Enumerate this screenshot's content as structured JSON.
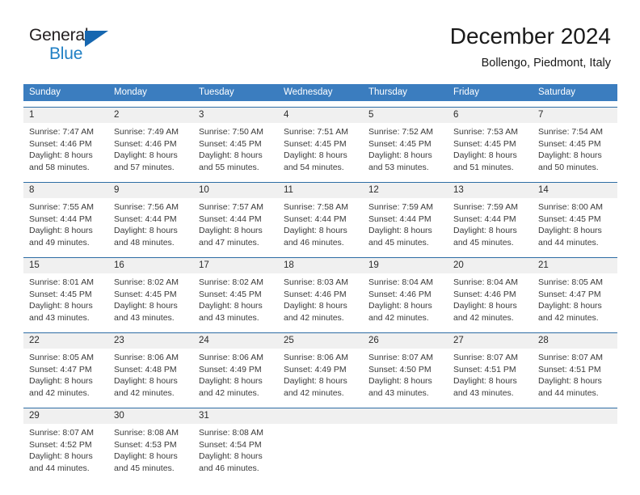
{
  "brand": {
    "name_primary": "General",
    "name_secondary": "Blue",
    "triangle_color": "#1667b0",
    "primary_color": "#231f20",
    "secondary_color": "#1f7fc4"
  },
  "header": {
    "title": "December 2024",
    "subtitle": "Bollengo, Piedmont, Italy"
  },
  "theme": {
    "header_bg": "#3b7dbf",
    "header_text": "#ffffff",
    "week_rule": "#2e6da4",
    "daynum_bg": "#f0f0f0",
    "body_text": "#3a3a3a"
  },
  "weekdays": [
    "Sunday",
    "Monday",
    "Tuesday",
    "Wednesday",
    "Thursday",
    "Friday",
    "Saturday"
  ],
  "weeks": [
    {
      "days": [
        {
          "num": "1",
          "sunrise": "Sunrise: 7:47 AM",
          "sunset": "Sunset: 4:46 PM",
          "daylight_1": "Daylight: 8 hours",
          "daylight_2": "and 58 minutes."
        },
        {
          "num": "2",
          "sunrise": "Sunrise: 7:49 AM",
          "sunset": "Sunset: 4:46 PM",
          "daylight_1": "Daylight: 8 hours",
          "daylight_2": "and 57 minutes."
        },
        {
          "num": "3",
          "sunrise": "Sunrise: 7:50 AM",
          "sunset": "Sunset: 4:45 PM",
          "daylight_1": "Daylight: 8 hours",
          "daylight_2": "and 55 minutes."
        },
        {
          "num": "4",
          "sunrise": "Sunrise: 7:51 AM",
          "sunset": "Sunset: 4:45 PM",
          "daylight_1": "Daylight: 8 hours",
          "daylight_2": "and 54 minutes."
        },
        {
          "num": "5",
          "sunrise": "Sunrise: 7:52 AM",
          "sunset": "Sunset: 4:45 PM",
          "daylight_1": "Daylight: 8 hours",
          "daylight_2": "and 53 minutes."
        },
        {
          "num": "6",
          "sunrise": "Sunrise: 7:53 AM",
          "sunset": "Sunset: 4:45 PM",
          "daylight_1": "Daylight: 8 hours",
          "daylight_2": "and 51 minutes."
        },
        {
          "num": "7",
          "sunrise": "Sunrise: 7:54 AM",
          "sunset": "Sunset: 4:45 PM",
          "daylight_1": "Daylight: 8 hours",
          "daylight_2": "and 50 minutes."
        }
      ]
    },
    {
      "days": [
        {
          "num": "8",
          "sunrise": "Sunrise: 7:55 AM",
          "sunset": "Sunset: 4:44 PM",
          "daylight_1": "Daylight: 8 hours",
          "daylight_2": "and 49 minutes."
        },
        {
          "num": "9",
          "sunrise": "Sunrise: 7:56 AM",
          "sunset": "Sunset: 4:44 PM",
          "daylight_1": "Daylight: 8 hours",
          "daylight_2": "and 48 minutes."
        },
        {
          "num": "10",
          "sunrise": "Sunrise: 7:57 AM",
          "sunset": "Sunset: 4:44 PM",
          "daylight_1": "Daylight: 8 hours",
          "daylight_2": "and 47 minutes."
        },
        {
          "num": "11",
          "sunrise": "Sunrise: 7:58 AM",
          "sunset": "Sunset: 4:44 PM",
          "daylight_1": "Daylight: 8 hours",
          "daylight_2": "and 46 minutes."
        },
        {
          "num": "12",
          "sunrise": "Sunrise: 7:59 AM",
          "sunset": "Sunset: 4:44 PM",
          "daylight_1": "Daylight: 8 hours",
          "daylight_2": "and 45 minutes."
        },
        {
          "num": "13",
          "sunrise": "Sunrise: 7:59 AM",
          "sunset": "Sunset: 4:44 PM",
          "daylight_1": "Daylight: 8 hours",
          "daylight_2": "and 45 minutes."
        },
        {
          "num": "14",
          "sunrise": "Sunrise: 8:00 AM",
          "sunset": "Sunset: 4:45 PM",
          "daylight_1": "Daylight: 8 hours",
          "daylight_2": "and 44 minutes."
        }
      ]
    },
    {
      "days": [
        {
          "num": "15",
          "sunrise": "Sunrise: 8:01 AM",
          "sunset": "Sunset: 4:45 PM",
          "daylight_1": "Daylight: 8 hours",
          "daylight_2": "and 43 minutes."
        },
        {
          "num": "16",
          "sunrise": "Sunrise: 8:02 AM",
          "sunset": "Sunset: 4:45 PM",
          "daylight_1": "Daylight: 8 hours",
          "daylight_2": "and 43 minutes."
        },
        {
          "num": "17",
          "sunrise": "Sunrise: 8:02 AM",
          "sunset": "Sunset: 4:45 PM",
          "daylight_1": "Daylight: 8 hours",
          "daylight_2": "and 43 minutes."
        },
        {
          "num": "18",
          "sunrise": "Sunrise: 8:03 AM",
          "sunset": "Sunset: 4:46 PM",
          "daylight_1": "Daylight: 8 hours",
          "daylight_2": "and 42 minutes."
        },
        {
          "num": "19",
          "sunrise": "Sunrise: 8:04 AM",
          "sunset": "Sunset: 4:46 PM",
          "daylight_1": "Daylight: 8 hours",
          "daylight_2": "and 42 minutes."
        },
        {
          "num": "20",
          "sunrise": "Sunrise: 8:04 AM",
          "sunset": "Sunset: 4:46 PM",
          "daylight_1": "Daylight: 8 hours",
          "daylight_2": "and 42 minutes."
        },
        {
          "num": "21",
          "sunrise": "Sunrise: 8:05 AM",
          "sunset": "Sunset: 4:47 PM",
          "daylight_1": "Daylight: 8 hours",
          "daylight_2": "and 42 minutes."
        }
      ]
    },
    {
      "days": [
        {
          "num": "22",
          "sunrise": "Sunrise: 8:05 AM",
          "sunset": "Sunset: 4:47 PM",
          "daylight_1": "Daylight: 8 hours",
          "daylight_2": "and 42 minutes."
        },
        {
          "num": "23",
          "sunrise": "Sunrise: 8:06 AM",
          "sunset": "Sunset: 4:48 PM",
          "daylight_1": "Daylight: 8 hours",
          "daylight_2": "and 42 minutes."
        },
        {
          "num": "24",
          "sunrise": "Sunrise: 8:06 AM",
          "sunset": "Sunset: 4:49 PM",
          "daylight_1": "Daylight: 8 hours",
          "daylight_2": "and 42 minutes."
        },
        {
          "num": "25",
          "sunrise": "Sunrise: 8:06 AM",
          "sunset": "Sunset: 4:49 PM",
          "daylight_1": "Daylight: 8 hours",
          "daylight_2": "and 42 minutes."
        },
        {
          "num": "26",
          "sunrise": "Sunrise: 8:07 AM",
          "sunset": "Sunset: 4:50 PM",
          "daylight_1": "Daylight: 8 hours",
          "daylight_2": "and 43 minutes."
        },
        {
          "num": "27",
          "sunrise": "Sunrise: 8:07 AM",
          "sunset": "Sunset: 4:51 PM",
          "daylight_1": "Daylight: 8 hours",
          "daylight_2": "and 43 minutes."
        },
        {
          "num": "28",
          "sunrise": "Sunrise: 8:07 AM",
          "sunset": "Sunset: 4:51 PM",
          "daylight_1": "Daylight: 8 hours",
          "daylight_2": "and 44 minutes."
        }
      ]
    },
    {
      "days": [
        {
          "num": "29",
          "sunrise": "Sunrise: 8:07 AM",
          "sunset": "Sunset: 4:52 PM",
          "daylight_1": "Daylight: 8 hours",
          "daylight_2": "and 44 minutes."
        },
        {
          "num": "30",
          "sunrise": "Sunrise: 8:08 AM",
          "sunset": "Sunset: 4:53 PM",
          "daylight_1": "Daylight: 8 hours",
          "daylight_2": "and 45 minutes."
        },
        {
          "num": "31",
          "sunrise": "Sunrise: 8:08 AM",
          "sunset": "Sunset: 4:54 PM",
          "daylight_1": "Daylight: 8 hours",
          "daylight_2": "and 46 minutes."
        },
        {
          "num": "",
          "sunrise": "",
          "sunset": "",
          "daylight_1": "",
          "daylight_2": ""
        },
        {
          "num": "",
          "sunrise": "",
          "sunset": "",
          "daylight_1": "",
          "daylight_2": ""
        },
        {
          "num": "",
          "sunrise": "",
          "sunset": "",
          "daylight_1": "",
          "daylight_2": ""
        },
        {
          "num": "",
          "sunrise": "",
          "sunset": "",
          "daylight_1": "",
          "daylight_2": ""
        }
      ]
    }
  ]
}
